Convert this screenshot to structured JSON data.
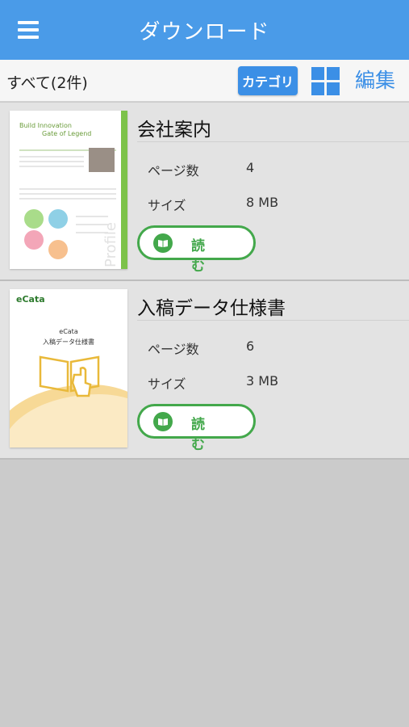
{
  "header": {
    "title": "ダウンロード",
    "menu_icon": "hamburger-menu-icon"
  },
  "toolbar": {
    "count_label": "すべて(2件)",
    "category_label": "カテゴリ",
    "grid_icon": "grid-view-icon",
    "edit_label": "編集",
    "accent_color": "#3b8fe6"
  },
  "items": [
    {
      "title": "会社案内",
      "pages_label": "ページ数",
      "pages_value": "4",
      "size_label": "サイズ",
      "size_value": "8 MB",
      "read_label": "読む",
      "thumb": {
        "heading1": "Build Innovation",
        "heading2": "Gate of Legend",
        "side_text": "Profile"
      }
    },
    {
      "title": "入稿データ仕様書",
      "pages_label": "ページ数",
      "pages_value": "6",
      "size_label": "サイズ",
      "size_value": "3 MB",
      "read_label": "読む",
      "thumb": {
        "logo": "eCata",
        "name1": "eCata",
        "name2": "入稿データ仕様書"
      }
    }
  ],
  "colors": {
    "header": "#4a9be8",
    "read_button": "#43a84b"
  }
}
